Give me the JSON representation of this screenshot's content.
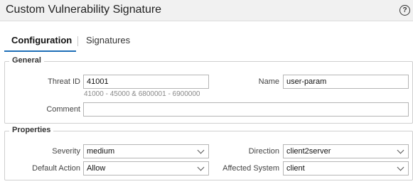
{
  "window": {
    "title": "Custom Vulnerability Signature",
    "help_icon": "?"
  },
  "tabs": [
    {
      "label": "Configuration",
      "active": true
    },
    {
      "label": "Signatures",
      "active": false
    }
  ],
  "general": {
    "legend": "General",
    "threat_id": {
      "label": "Threat ID",
      "value": "41001",
      "hint": "41000 - 45000 & 6800001 - 6900000"
    },
    "name": {
      "label": "Name",
      "value": "user-param"
    },
    "comment": {
      "label": "Comment",
      "value": ""
    }
  },
  "properties": {
    "legend": "Properties",
    "severity": {
      "label": "Severity",
      "value": "medium"
    },
    "direction": {
      "label": "Direction",
      "value": "client2server"
    },
    "default_action": {
      "label": "Default Action",
      "value": "Allow"
    },
    "affected_system": {
      "label": "Affected System",
      "value": "client"
    }
  },
  "colors": {
    "accent": "#1e6fb7",
    "titlebar": "#f1f1f1",
    "border": "#cfcfcf"
  }
}
